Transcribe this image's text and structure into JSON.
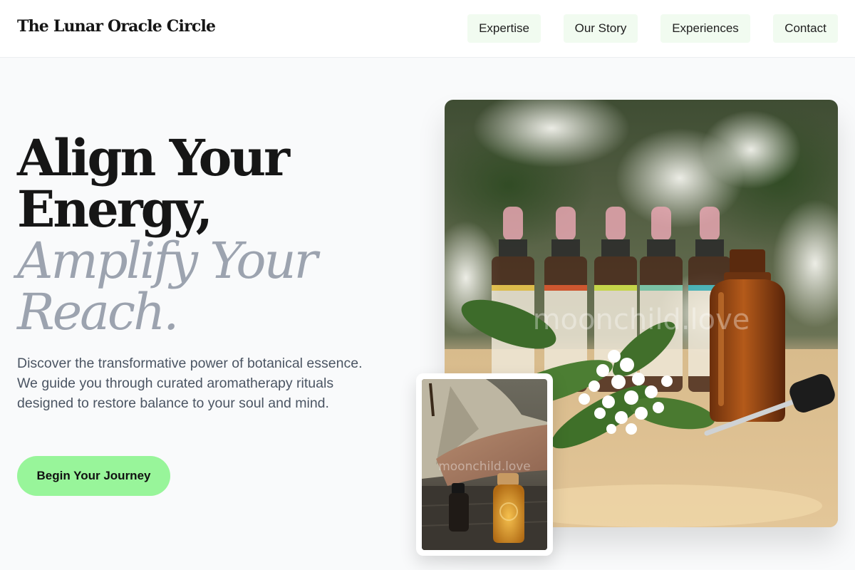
{
  "header": {
    "brand": "The Lunar Oracle Circle",
    "nav": [
      {
        "label": "Expertise"
      },
      {
        "label": "Our Story"
      },
      {
        "label": "Experiences"
      },
      {
        "label": "Contact"
      }
    ]
  },
  "hero": {
    "headline_line1": "Align Your",
    "headline_line2": "Energy,",
    "headline_accent_line1": "Amplify Your",
    "headline_accent_line2": "Reach.",
    "description": "Discover the transformative power of botanical essence. We guide you through curated aromatherapy rituals designed to restore balance to your soul and mind.",
    "cta_label": "Begin Your Journey"
  },
  "images": {
    "main_watermark": "moonchild.love",
    "inset_watermark": "moonchild.love"
  },
  "colors": {
    "accent_green": "#98f59a",
    "nav_bg": "#f1fbf0",
    "muted_text": "#9ca3af"
  }
}
